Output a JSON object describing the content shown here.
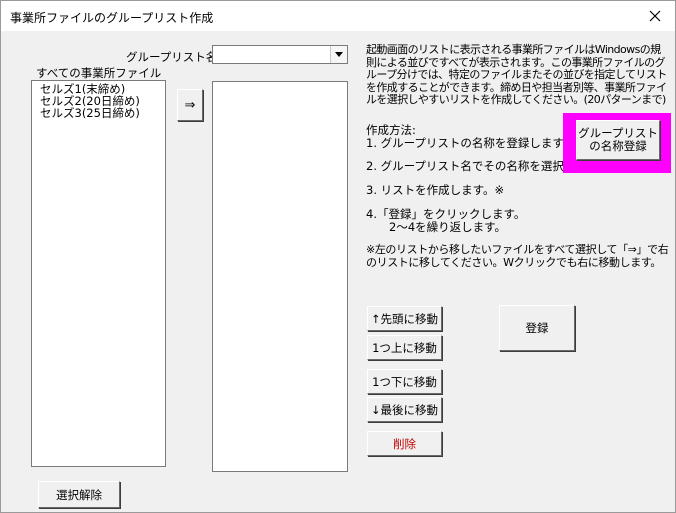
{
  "window": {
    "title": "事業所ファイルのグループリスト作成",
    "close_glyph": "✕"
  },
  "group_list": {
    "label": "グループリスト名",
    "value": ""
  },
  "all_files": {
    "label": "すべての事業所ファイル",
    "items": [
      "セルズ1(末締め)",
      "セルズ2(20日締め)",
      "セルズ3(25日締め)"
    ]
  },
  "move_button": "⇒",
  "description": "起動画面のリストに表示される事業所ファイルはWindowsの規則による並びですべてが表示されます。この事業所ファイルのグループ分けでは、特定のファイルまたその並びを指定してリストを作成することができます。締め日や担当者別等、事業所ファイルを選択しやすいリストを作成してください。(20パターンまで)",
  "method": {
    "heading": "作成方法:",
    "step1": "1. グループリストの名称を登録します。",
    "step2": "2. グループリスト名でその名称を選択",
    "step3": "3. リストを作成します。※",
    "step4a": "4.「登録」をクリックします。",
    "step4b": "2〜4を繰り返します。",
    "note1": "※左のリストから移したいファイルをすべて選択して「⇒」で右",
    "note2": "のリストに移してください。Wクリックでも右に移動します。"
  },
  "register_name_button": {
    "line1": "グループリスト",
    "line2": "の名称登録"
  },
  "buttons": {
    "move_top": "↑先頭に移動",
    "move_up": "1つ上に移動",
    "move_down": "1つ下に移動",
    "move_bottom": "↓最後に移動",
    "delete": "削除",
    "register": "登録",
    "clear_selection": "選択解除"
  },
  "colors": {
    "highlight": "#ff00ff",
    "delete_text": "#c00000"
  }
}
